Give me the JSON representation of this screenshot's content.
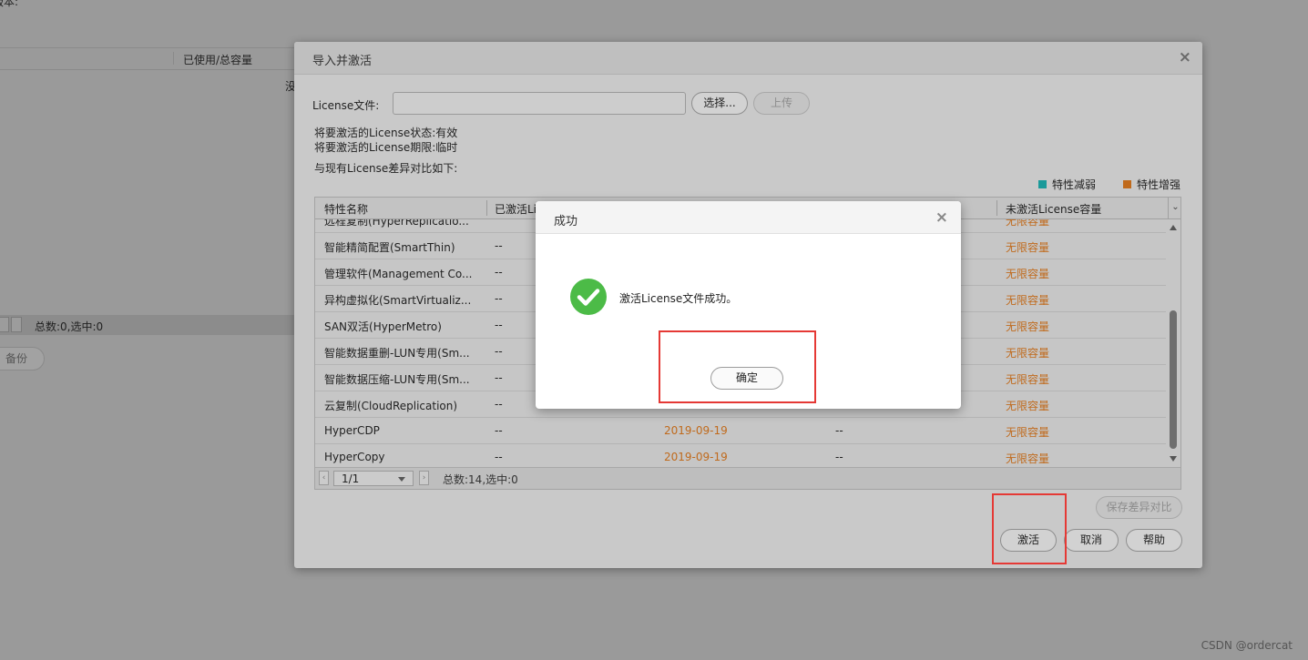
{
  "background": {
    "version_label": "版本:",
    "column_header": "已使用/总容量",
    "partial_text": "没",
    "pager_info": "总数:0,选中:0",
    "backup_button": "备份"
  },
  "dialog": {
    "title": "导入并激活",
    "license_file_label": "License文件:",
    "license_file_value": "",
    "select_button": "选择...",
    "upload_button": "上传",
    "status_line": "将要激活的License状态:有效",
    "term_line": "将要激活的License期限:临时",
    "compare_line": "与现有License差异对比如下:",
    "legend": {
      "weaken": {
        "label": "特性减弱",
        "color": "#1a9a9a"
      },
      "enhance": {
        "label": "特性增强",
        "color": "#c06a1c"
      }
    },
    "table": {
      "headers": [
        "特性名称",
        "已激活Li",
        "未激活License容量"
      ],
      "rows": [
        {
          "name": "远程复制(HyperReplicatio...",
          "active": "",
          "date": "",
          "other": "",
          "capacity": "无限容量"
        },
        {
          "name": "智能精简配置(SmartThin)",
          "active": "--",
          "date": "",
          "other": "",
          "capacity": "无限容量"
        },
        {
          "name": "管理软件(Management Co...",
          "active": "--",
          "date": "",
          "other": "",
          "capacity": "无限容量"
        },
        {
          "name": "异构虚拟化(SmartVirtualiz...",
          "active": "--",
          "date": "",
          "other": "",
          "capacity": "无限容量"
        },
        {
          "name": "SAN双活(HyperMetro)",
          "active": "--",
          "date": "",
          "other": "",
          "capacity": "无限容量"
        },
        {
          "name": "智能数据重删-LUN专用(Sm...",
          "active": "--",
          "date": "",
          "other": "",
          "capacity": "无限容量"
        },
        {
          "name": "智能数据压缩-LUN专用(Sm...",
          "active": "--",
          "date": "",
          "other": "",
          "capacity": "无限容量"
        },
        {
          "name": "云复制(CloudReplication)",
          "active": "--",
          "date": "",
          "other": "",
          "capacity": "无限容量"
        },
        {
          "name": "HyperCDP",
          "active": "--",
          "date": "2019-09-19",
          "other": "--",
          "capacity": "无限容量"
        },
        {
          "name": "HyperCopy",
          "active": "--",
          "date": "2019-09-19",
          "other": "--",
          "capacity": "无限容量"
        }
      ],
      "pager_page": "1/1",
      "pager_info": "总数:14,选中:0"
    },
    "save_compare_button": "保存差异对比",
    "activate_button": "激活",
    "cancel_button": "取消",
    "help_button": "帮助"
  },
  "modal": {
    "title": "成功",
    "message": "激活License文件成功。",
    "ok_button": "确定",
    "icon_color": "#4cbb47"
  },
  "watermark": "CSDN @ordercat"
}
